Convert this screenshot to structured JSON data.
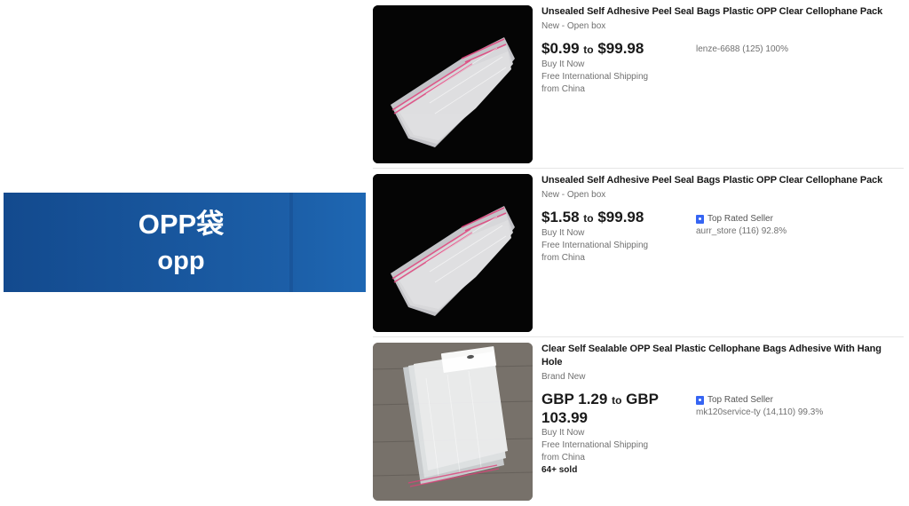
{
  "banner": {
    "title": "OPP袋",
    "subtitle": "opp"
  },
  "listings": [
    {
      "title": "Unsealed Self Adhesive Peel Seal Bags Plastic OPP Clear Cellophane Pack",
      "condition": "New - Open box",
      "price_low": "$0.99",
      "price_to": "to",
      "price_high": "$99.98",
      "buy_format": "Buy It Now",
      "shipping_line1": "Free International Shipping",
      "shipping_line2": "from China",
      "seller": "lenze-6688 (125) 100%"
    },
    {
      "title": "Unsealed Self Adhesive Peel Seal Bags Plastic OPP Clear Cellophane Pack",
      "condition": "New - Open box",
      "price_low": "$1.58",
      "price_to": "to",
      "price_high": "$99.98",
      "buy_format": "Buy It Now",
      "shipping_line1": "Free International Shipping",
      "shipping_line2": "from China",
      "badge": "Top Rated Seller",
      "badge_icon": "top-rated-seller-icon",
      "seller": "aurr_store (116) 92.8%"
    },
    {
      "title": "Clear Self Sealable OPP Seal Plastic Cellophane Bags Adhesive With Hang Hole",
      "condition": "Brand New",
      "price_low": "GBP 1.29",
      "price_to": "to",
      "price_high": "GBP 103.99",
      "buy_format": "Buy It Now",
      "shipping_line1": "Free International Shipping",
      "shipping_line2": "from China",
      "sold": "64+ sold",
      "badge": "Top Rated Seller",
      "badge_icon": "top-rated-seller-icon",
      "seller": "mk120service-ty (14,110) 99.3%"
    }
  ],
  "colors": {
    "banner_blue": "#1c5fa8",
    "badge_blue": "#3665f3",
    "seal_stripe_pink": "#e0407a"
  }
}
